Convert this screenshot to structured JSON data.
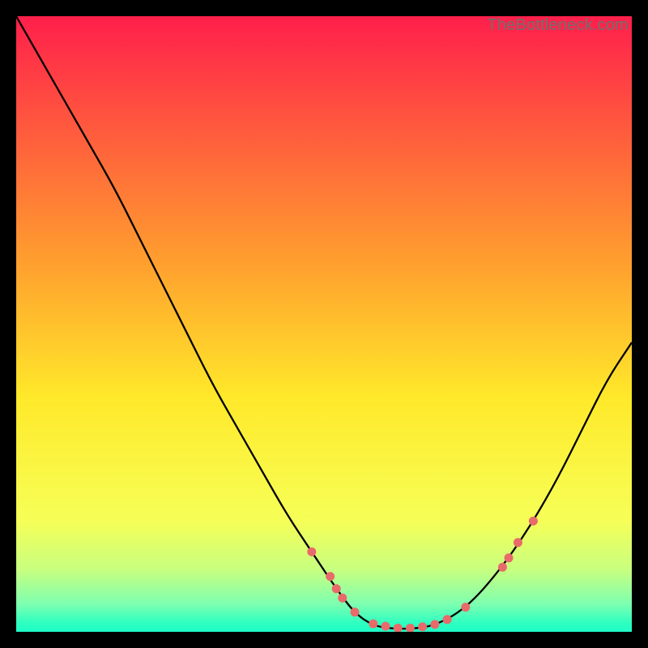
{
  "watermark": "TheBottleneck.com",
  "chart_data": {
    "type": "line",
    "title": "",
    "xlabel": "",
    "ylabel": "",
    "xlim": [
      0,
      100
    ],
    "ylim": [
      0,
      100
    ],
    "background": {
      "gradient_stops": [
        {
          "pos": 0.0,
          "color": "#ff1f4b"
        },
        {
          "pos": 0.4,
          "color": "#ff9f2e"
        },
        {
          "pos": 0.62,
          "color": "#ffe92a"
        },
        {
          "pos": 0.82,
          "color": "#f6ff57"
        },
        {
          "pos": 0.9,
          "color": "#c7ff80"
        },
        {
          "pos": 0.955,
          "color": "#7dffb0"
        },
        {
          "pos": 0.985,
          "color": "#2fffc0"
        },
        {
          "pos": 1.0,
          "color": "#1effc6"
        }
      ]
    },
    "series": [
      {
        "name": "bottleneck-curve",
        "color": "#000000",
        "x": [
          0,
          4,
          8,
          12,
          16,
          20,
          24,
          28,
          32,
          36,
          40,
          44,
          48,
          52,
          55,
          58,
          61,
          64,
          67,
          70,
          73,
          76,
          80,
          84,
          88,
          92,
          96,
          100
        ],
        "y": [
          100,
          93,
          86,
          79,
          72,
          64,
          56,
          48,
          40,
          33,
          26,
          19,
          13,
          7,
          3,
          1,
          0.5,
          0.5,
          0.8,
          2,
          4,
          7,
          12,
          18,
          25,
          33,
          41,
          47
        ]
      }
    ],
    "scatter": {
      "name": "highlight-points",
      "color": "#e86a6a",
      "radius": 5.5,
      "points": [
        {
          "x": 48,
          "y": 13
        },
        {
          "x": 51,
          "y": 9
        },
        {
          "x": 52,
          "y": 7
        },
        {
          "x": 53,
          "y": 5.5
        },
        {
          "x": 55,
          "y": 3.2
        },
        {
          "x": 58,
          "y": 1.3
        },
        {
          "x": 60,
          "y": 0.9
        },
        {
          "x": 62,
          "y": 0.6
        },
        {
          "x": 64,
          "y": 0.6
        },
        {
          "x": 66,
          "y": 0.8
        },
        {
          "x": 68,
          "y": 1.2
        },
        {
          "x": 70,
          "y": 2
        },
        {
          "x": 73,
          "y": 4
        },
        {
          "x": 79,
          "y": 10.5
        },
        {
          "x": 80,
          "y": 12
        },
        {
          "x": 81.5,
          "y": 14.5
        },
        {
          "x": 84,
          "y": 18
        }
      ]
    }
  }
}
